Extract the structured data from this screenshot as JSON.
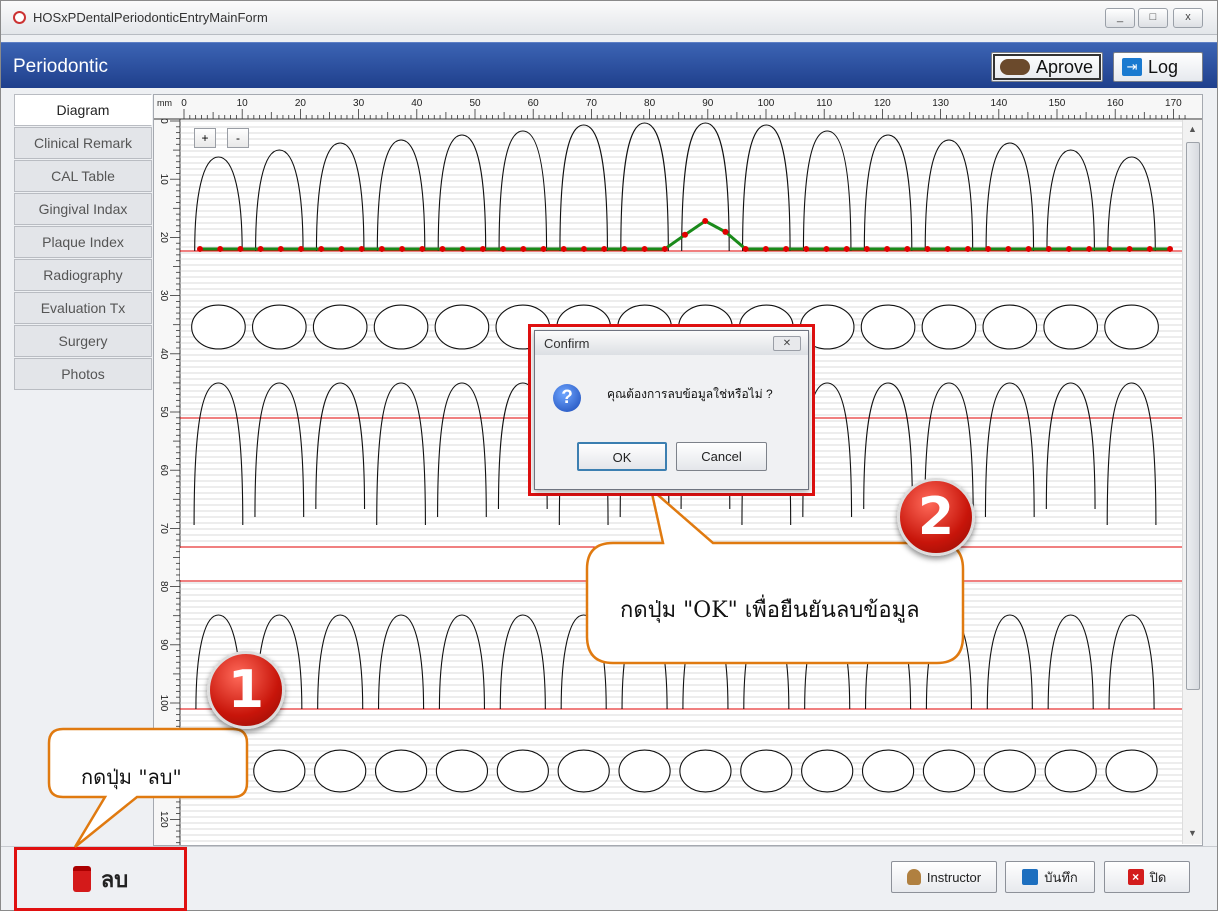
{
  "window": {
    "title": "HOSxPDentalPeriodonticEntryMainForm",
    "min": "_",
    "max": "□",
    "close": "x"
  },
  "header": {
    "title": "Periodontic",
    "approve_label": "Aprove",
    "log_label": "Log"
  },
  "tabs": [
    "Diagram",
    "Clinical Remark",
    "CAL Table",
    "Gingival Indax",
    "Plaque Index",
    "Radiography",
    "Evaluation Tx",
    "Surgery",
    "Photos"
  ],
  "active_tab": "Diagram",
  "ruler": {
    "unit": "mm",
    "top_ticks": [
      "0",
      "10",
      "20",
      "30",
      "40",
      "50",
      "60",
      "70",
      "80",
      "90",
      "100",
      "110",
      "120",
      "130",
      "140",
      "150",
      "160",
      "170"
    ],
    "left_ticks": [
      "0",
      "10",
      "20",
      "30",
      "40",
      "50",
      "60",
      "70",
      "80",
      "90",
      "100",
      "110",
      "120"
    ]
  },
  "zoom": {
    "plus": "+",
    "minus": "-"
  },
  "dialog": {
    "title": "Confirm",
    "message": "คุณต้องการลบข้อมูลใช่หรือไม่ ?",
    "ok": "OK",
    "cancel": "Cancel",
    "icon": "question-icon"
  },
  "bottom": {
    "delete_label": "ลบ",
    "instructor_label": "Instructor",
    "save_label": "บันทึก",
    "close_label": "ปิด"
  },
  "callouts": [
    {
      "number": "1",
      "text": "กดปุ่ม \"ลบ\""
    },
    {
      "number": "2",
      "text": "กดปุ่ม \"OK\" เพื่อยืนยันลบข้อมูล"
    }
  ],
  "colors": {
    "header_blue": "#2a4fa0",
    "annotation_red": "#e01010",
    "gum_line": "#1a8a1a",
    "margin_line": "#e00000"
  }
}
